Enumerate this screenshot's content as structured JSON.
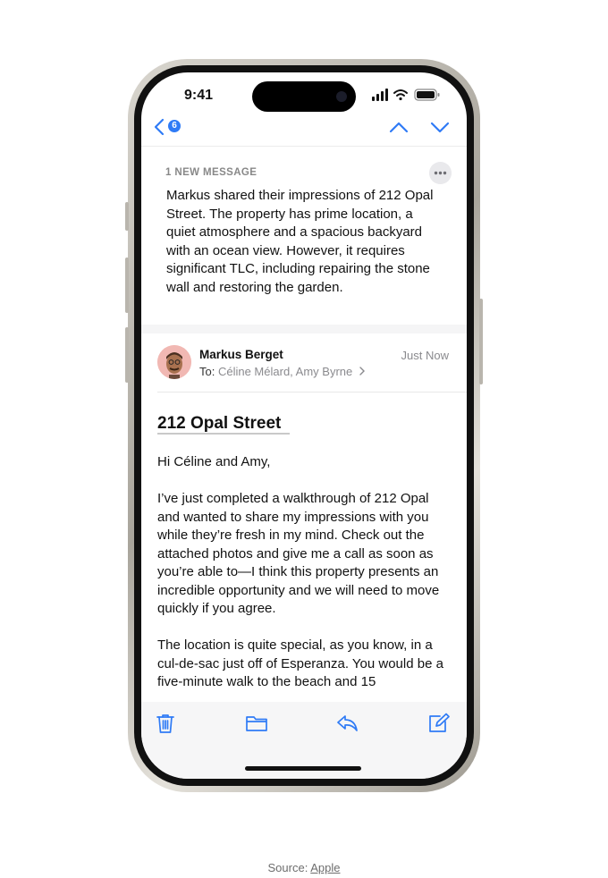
{
  "status_bar": {
    "time": "9:41"
  },
  "nav": {
    "unread_count": "6"
  },
  "summary": {
    "label": "1 NEW MESSAGE",
    "text": "Markus shared their impressions of 212 Opal Street. The property has prime location, a quiet atmosphere and a spacious backyard with an ocean view. However, it requires significant TLC, including repairing the stone wall and restoring the garden."
  },
  "message": {
    "sender": "Markus Berget",
    "timestamp": "Just Now",
    "to_label": "To:",
    "recipients": "Céline Mélard, Amy Byrne",
    "subject": "212 Opal Street",
    "greeting": "Hi Céline and Amy,",
    "paragraph1": "I’ve just completed a walkthrough of 212 Opal and wanted to share my impressions with you while they’re fresh in my mind. Check out the attached photos and give me a call as soon as you’re able to—I think this property presents an incredible opportunity and we will need to move quickly if you agree.",
    "paragraph2": "The location is quite special, as you know, in a cul-de-sac just off of Esperanza. You would be a five-minute walk to the beach and 15"
  },
  "toolbar": {
    "icons": [
      "trash-icon",
      "folder-icon",
      "reply-icon",
      "compose-icon"
    ]
  },
  "caption": {
    "prefix": "Source:",
    "link": "Apple"
  },
  "colors": {
    "accent": "#2f7bf6",
    "secondary_text": "#8a8a8e",
    "avatar_bg": "#f1b8b3"
  }
}
